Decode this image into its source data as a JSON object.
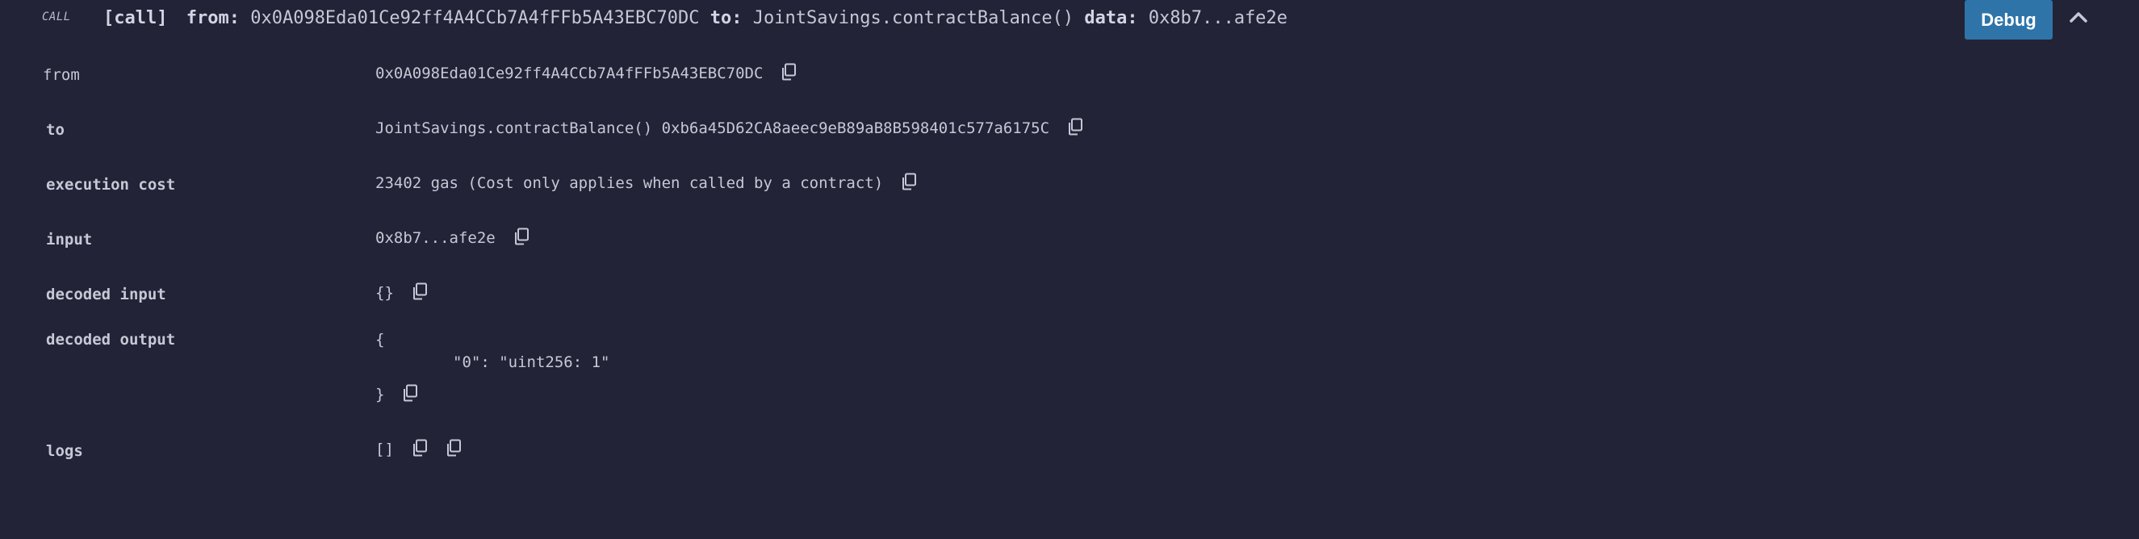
{
  "header": {
    "badge": "CALL",
    "call_tag": "[call]",
    "from_kw": "from:",
    "from_value": "0x0A098Eda01Ce92ff4A4CCb7A4fFFb5A43EBC70DC",
    "to_kw": "to:",
    "to_value": "JointSavings.contractBalance()",
    "data_kw": "data:",
    "data_value": "0x8b7...afe2e",
    "debug_label": "Debug"
  },
  "rows": {
    "from": {
      "label": "from",
      "value": "0x0A098Eda01Ce92ff4A4CCb7A4fFFb5A43EBC70DC"
    },
    "to": {
      "label": "to",
      "value": "JointSavings.contractBalance() 0xb6a45D62CA8aeec9eB89aB8B598401c577a6175C"
    },
    "execution_cost": {
      "label": "execution cost",
      "value": "23402 gas (Cost only applies when called by a contract)"
    },
    "input": {
      "label": "input",
      "value": "0x8b7...afe2e"
    },
    "decoded_input": {
      "label": "decoded input",
      "value": "{}"
    },
    "decoded_output": {
      "label": "decoded output",
      "open": "{",
      "entry": "\"0\": \"uint256: 1\"",
      "close": "}"
    },
    "logs": {
      "label": "logs",
      "value": "[]"
    }
  },
  "colors": {
    "background": "#222336",
    "text": "#c6c8d6",
    "debug_button": "#2f74a9"
  },
  "icons": {
    "copy": "copy-icon",
    "collapse": "chevron-up-icon"
  }
}
